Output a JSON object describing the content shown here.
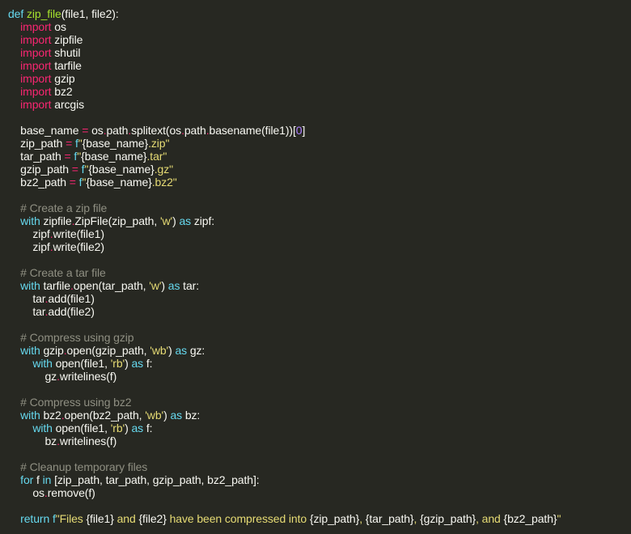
{
  "editor": {
    "colors": {
      "background": "#272822",
      "plain": "#f8f8f2",
      "keyword": "#66d9ef",
      "import": "#f92672",
      "function": "#a6e22e",
      "operator": "#f92672",
      "string": "#e6db74",
      "number": "#ae81ff",
      "comment": "#8f8f82"
    },
    "lines": [
      [
        {
          "t": "def",
          "c": "kw"
        },
        {
          "t": " ",
          "c": "plain"
        },
        {
          "t": "zip_file",
          "c": "fn"
        },
        {
          "t": "(file1, file2):",
          "c": "plain"
        }
      ],
      [
        {
          "t": "    ",
          "c": "plain"
        },
        {
          "t": "import",
          "c": "imp"
        },
        {
          "t": " os",
          "c": "plain"
        }
      ],
      [
        {
          "t": "    ",
          "c": "plain"
        },
        {
          "t": "import",
          "c": "imp"
        },
        {
          "t": " zipfile",
          "c": "plain"
        }
      ],
      [
        {
          "t": "    ",
          "c": "plain"
        },
        {
          "t": "import",
          "c": "imp"
        },
        {
          "t": " shutil",
          "c": "plain"
        }
      ],
      [
        {
          "t": "    ",
          "c": "plain"
        },
        {
          "t": "import",
          "c": "imp"
        },
        {
          "t": " tarfile",
          "c": "plain"
        }
      ],
      [
        {
          "t": "    ",
          "c": "plain"
        },
        {
          "t": "import",
          "c": "imp"
        },
        {
          "t": " gzip",
          "c": "plain"
        }
      ],
      [
        {
          "t": "    ",
          "c": "plain"
        },
        {
          "t": "import",
          "c": "imp"
        },
        {
          "t": " bz2",
          "c": "plain"
        }
      ],
      [
        {
          "t": "    ",
          "c": "plain"
        },
        {
          "t": "import",
          "c": "imp"
        },
        {
          "t": " arcgis",
          "c": "plain"
        }
      ],
      [],
      [
        {
          "t": "    base_name ",
          "c": "plain"
        },
        {
          "t": "=",
          "c": "op"
        },
        {
          "t": " os",
          "c": "plain"
        },
        {
          "t": ".",
          "c": "op"
        },
        {
          "t": "path",
          "c": "plain"
        },
        {
          "t": ".",
          "c": "op"
        },
        {
          "t": "splitext(os",
          "c": "plain"
        },
        {
          "t": ".",
          "c": "op"
        },
        {
          "t": "path",
          "c": "plain"
        },
        {
          "t": ".",
          "c": "op"
        },
        {
          "t": "basename(file1))[",
          "c": "plain"
        },
        {
          "t": "0",
          "c": "num"
        },
        {
          "t": "]",
          "c": "plain"
        }
      ],
      [
        {
          "t": "    zip_path ",
          "c": "plain"
        },
        {
          "t": "=",
          "c": "op"
        },
        {
          "t": " f",
          "c": "kw"
        },
        {
          "t": "\"",
          "c": "str"
        },
        {
          "t": "{base_name}",
          "c": "plain"
        },
        {
          "t": ".zip\"",
          "c": "str"
        }
      ],
      [
        {
          "t": "    tar_path ",
          "c": "plain"
        },
        {
          "t": "=",
          "c": "op"
        },
        {
          "t": " f",
          "c": "kw"
        },
        {
          "t": "\"",
          "c": "str"
        },
        {
          "t": "{base_name}",
          "c": "plain"
        },
        {
          "t": ".tar\"",
          "c": "str"
        }
      ],
      [
        {
          "t": "    gzip_path ",
          "c": "plain"
        },
        {
          "t": "=",
          "c": "op"
        },
        {
          "t": " f",
          "c": "kw"
        },
        {
          "t": "\"",
          "c": "str"
        },
        {
          "t": "{base_name}",
          "c": "plain"
        },
        {
          "t": ".gz\"",
          "c": "str"
        }
      ],
      [
        {
          "t": "    bz2_path ",
          "c": "plain"
        },
        {
          "t": "=",
          "c": "op"
        },
        {
          "t": " f",
          "c": "kw"
        },
        {
          "t": "\"",
          "c": "str"
        },
        {
          "t": "{base_name}",
          "c": "plain"
        },
        {
          "t": ".bz2\"",
          "c": "str"
        }
      ],
      [],
      [
        {
          "t": "    # Create a zip file",
          "c": "cmt"
        }
      ],
      [
        {
          "t": "    ",
          "c": "plain"
        },
        {
          "t": "with",
          "c": "kw"
        },
        {
          "t": " zipfile",
          "c": "plain"
        },
        {
          "t": ".",
          "c": "op"
        },
        {
          "t": "ZipFile(zip_path, ",
          "c": "plain"
        },
        {
          "t": "'w'",
          "c": "str"
        },
        {
          "t": ") ",
          "c": "plain"
        },
        {
          "t": "as",
          "c": "kw"
        },
        {
          "t": " zipf:",
          "c": "plain"
        }
      ],
      [
        {
          "t": "        zipf",
          "c": "plain"
        },
        {
          "t": ".",
          "c": "op"
        },
        {
          "t": "write(file1)",
          "c": "plain"
        }
      ],
      [
        {
          "t": "        zipf",
          "c": "plain"
        },
        {
          "t": ".",
          "c": "op"
        },
        {
          "t": "write(file2)",
          "c": "plain"
        }
      ],
      [],
      [
        {
          "t": "    # Create a tar file",
          "c": "cmt"
        }
      ],
      [
        {
          "t": "    ",
          "c": "plain"
        },
        {
          "t": "with",
          "c": "kw"
        },
        {
          "t": " tarfile",
          "c": "plain"
        },
        {
          "t": ".",
          "c": "op"
        },
        {
          "t": "open(tar_path, ",
          "c": "plain"
        },
        {
          "t": "'w'",
          "c": "str"
        },
        {
          "t": ") ",
          "c": "plain"
        },
        {
          "t": "as",
          "c": "kw"
        },
        {
          "t": " tar:",
          "c": "plain"
        }
      ],
      [
        {
          "t": "        tar",
          "c": "plain"
        },
        {
          "t": ".",
          "c": "op"
        },
        {
          "t": "add(file1)",
          "c": "plain"
        }
      ],
      [
        {
          "t": "        tar",
          "c": "plain"
        },
        {
          "t": ".",
          "c": "op"
        },
        {
          "t": "add(file2)",
          "c": "plain"
        }
      ],
      [],
      [
        {
          "t": "    # Compress using gzip",
          "c": "cmt"
        }
      ],
      [
        {
          "t": "    ",
          "c": "plain"
        },
        {
          "t": "with",
          "c": "kw"
        },
        {
          "t": " gzip",
          "c": "plain"
        },
        {
          "t": ".",
          "c": "op"
        },
        {
          "t": "open(gzip_path, ",
          "c": "plain"
        },
        {
          "t": "'wb'",
          "c": "str"
        },
        {
          "t": ") ",
          "c": "plain"
        },
        {
          "t": "as",
          "c": "kw"
        },
        {
          "t": " gz:",
          "c": "plain"
        }
      ],
      [
        {
          "t": "        ",
          "c": "plain"
        },
        {
          "t": "with",
          "c": "kw"
        },
        {
          "t": " open(file1, ",
          "c": "plain"
        },
        {
          "t": "'rb'",
          "c": "str"
        },
        {
          "t": ") ",
          "c": "plain"
        },
        {
          "t": "as",
          "c": "kw"
        },
        {
          "t": " f:",
          "c": "plain"
        }
      ],
      [
        {
          "t": "            gz",
          "c": "plain"
        },
        {
          "t": ".",
          "c": "op"
        },
        {
          "t": "writelines(f)",
          "c": "plain"
        }
      ],
      [],
      [
        {
          "t": "    # Compress using bz2",
          "c": "cmt"
        }
      ],
      [
        {
          "t": "    ",
          "c": "plain"
        },
        {
          "t": "with",
          "c": "kw"
        },
        {
          "t": " bz2",
          "c": "plain"
        },
        {
          "t": ".",
          "c": "op"
        },
        {
          "t": "open(bz2_path, ",
          "c": "plain"
        },
        {
          "t": "'wb'",
          "c": "str"
        },
        {
          "t": ") ",
          "c": "plain"
        },
        {
          "t": "as",
          "c": "kw"
        },
        {
          "t": " bz:",
          "c": "plain"
        }
      ],
      [
        {
          "t": "        ",
          "c": "plain"
        },
        {
          "t": "with",
          "c": "kw"
        },
        {
          "t": " open(file1, ",
          "c": "plain"
        },
        {
          "t": "'rb'",
          "c": "str"
        },
        {
          "t": ") ",
          "c": "plain"
        },
        {
          "t": "as",
          "c": "kw"
        },
        {
          "t": " f:",
          "c": "plain"
        }
      ],
      [
        {
          "t": "            bz",
          "c": "plain"
        },
        {
          "t": ".",
          "c": "op"
        },
        {
          "t": "writelines(f)",
          "c": "plain"
        }
      ],
      [],
      [
        {
          "t": "    # Cleanup temporary files",
          "c": "cmt"
        }
      ],
      [
        {
          "t": "    ",
          "c": "plain"
        },
        {
          "t": "for",
          "c": "kw"
        },
        {
          "t": " f ",
          "c": "plain"
        },
        {
          "t": "in",
          "c": "kw"
        },
        {
          "t": " [zip_path, tar_path, gzip_path, bz2_path]:",
          "c": "plain"
        }
      ],
      [
        {
          "t": "        os",
          "c": "plain"
        },
        {
          "t": ".",
          "c": "op"
        },
        {
          "t": "remove(f)",
          "c": "plain"
        }
      ],
      [],
      [
        {
          "t": "    ",
          "c": "plain"
        },
        {
          "t": "return",
          "c": "kw"
        },
        {
          "t": " f",
          "c": "kw"
        },
        {
          "t": "\"Files ",
          "c": "str"
        },
        {
          "t": "{file1}",
          "c": "plain"
        },
        {
          "t": " and ",
          "c": "str"
        },
        {
          "t": "{file2}",
          "c": "plain"
        },
        {
          "t": " have been compressed into ",
          "c": "str"
        },
        {
          "t": "{zip_path}",
          "c": "plain"
        },
        {
          "t": ", ",
          "c": "str"
        },
        {
          "t": "{tar_path}",
          "c": "plain"
        },
        {
          "t": ", ",
          "c": "str"
        },
        {
          "t": "{gzip_path}",
          "c": "plain"
        },
        {
          "t": ", and ",
          "c": "str"
        },
        {
          "t": "{bz2_path}",
          "c": "plain"
        },
        {
          "t": "\"",
          "c": "str"
        }
      ]
    ]
  }
}
